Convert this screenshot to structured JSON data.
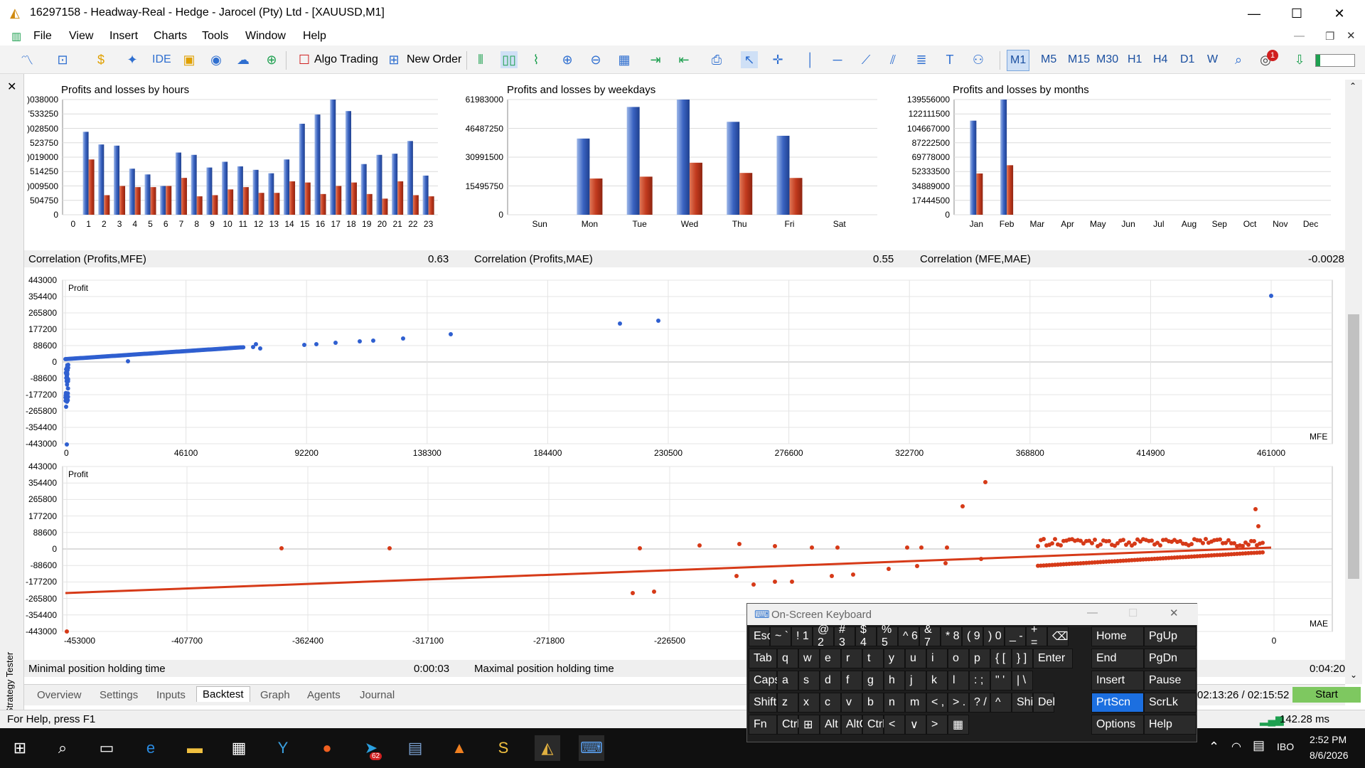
{
  "window": {
    "title": "16297158 - Headway-Real - Hedge - Jarocel (Pty) Ltd - [XAUUSD,M1]",
    "controls": [
      "—",
      "☐",
      "✕"
    ]
  },
  "menu": [
    "File",
    "View",
    "Insert",
    "Charts",
    "Tools",
    "Window",
    "Help"
  ],
  "toolbar": {
    "ide_label": "IDE",
    "algo_label": "Algo Trading",
    "neworder_label": "New Order",
    "timeframes": [
      "M1",
      "M5",
      "M15",
      "M30",
      "H1",
      "H4",
      "D1",
      "W"
    ],
    "selected_tf": "M1",
    "badge": "1"
  },
  "side_panel": {
    "label": "Strategy Tester"
  },
  "charts": {
    "hours_title": "Profits and losses by hours",
    "weekdays_title": "Profits and losses by weekdays",
    "months_title": "Profits and losses by months",
    "hours_yticks": [
      ")038000",
      "'533250",
      ")028500",
      "523750",
      ")019000",
      "514250",
      ")009500",
      "504750",
      "0"
    ],
    "weekdays_yticks": [
      "61983000",
      "46487250",
      "30991500",
      "15495750",
      "0"
    ],
    "months_yticks": [
      "139556000",
      "122111500",
      "104667000",
      "87222500",
      "69778000",
      "52333500",
      "34889000",
      "17444500",
      "0"
    ]
  },
  "correlation": {
    "c1_label": "Correlation (Profits,MFE)",
    "c1_value": "0.63",
    "c2_label": "Correlation (Profits,MAE)",
    "c2_value": "0.55",
    "c3_label": "Correlation (MFE,MAE)",
    "c3_value": "-0.0028"
  },
  "scatter": {
    "yticks": [
      "443000",
      "354400",
      "265800",
      "177200",
      "88600",
      "0",
      "-88600",
      "-177200",
      "-265800",
      "-354400",
      "-443000"
    ],
    "mfe_xticks": [
      "0",
      "46100",
      "92200",
      "138300",
      "184400",
      "230500",
      "276600",
      "322700",
      "368800",
      "414900",
      "461000"
    ],
    "mae_xticks": [
      "-453000",
      "-407700",
      "-362400",
      "-317100",
      "-271800",
      "-226500",
      "0"
    ],
    "profit_label": "Profit",
    "mfe_label": "MFE",
    "mae_label": "MAE"
  },
  "holding": {
    "min_label": "Minimal position holding time",
    "min_value": "0:00:03",
    "max_label": "Maximal position holding time",
    "max_value": "0:04:20"
  },
  "tabs": [
    "Overview",
    "Settings",
    "Inputs",
    "Backtest",
    "Graph",
    "Agents",
    "Journal"
  ],
  "active_tab": "Backtest",
  "progress": {
    "time": "02:13:26 / 02:15:52",
    "start_label": "Start"
  },
  "status": {
    "help": "For Help, press F1",
    "ping": "142.28 ms"
  },
  "osk": {
    "title": "On-Screen Keyboard",
    "row1": [
      "Esc",
      "~ `",
      "! 1",
      "@ 2",
      "# 3",
      "$ 4",
      "% 5",
      "^ 6",
      "& 7",
      "* 8",
      "( 9",
      ") 0",
      "_ -",
      "+ =",
      "⌫"
    ],
    "row2": [
      "Tab",
      "q",
      "w",
      "e",
      "r",
      "t",
      "y",
      "u",
      "i",
      "o",
      "p",
      "{ [",
      "} ]",
      "Enter"
    ],
    "row3": [
      "Caps",
      "a",
      "s",
      "d",
      "f",
      "g",
      "h",
      "j",
      "k",
      "l",
      ": ;",
      "\" '",
      "| \\"
    ],
    "row4": [
      "Shift",
      "z",
      "x",
      "c",
      "v",
      "b",
      "n",
      "m",
      "< ,",
      "> .",
      "? /",
      "^",
      "Shift",
      "Del"
    ],
    "row5": [
      "Fn",
      "Ctrl",
      "⊞",
      "Alt",
      "AltGr",
      "Ctrl",
      "<",
      "∨",
      ">",
      "▦"
    ],
    "nav": [
      [
        "Home",
        "PgUp"
      ],
      [
        "End",
        "PgDn"
      ],
      [
        "Insert",
        "Pause"
      ],
      [
        "PrtScn",
        "ScrLk"
      ],
      [
        "Options",
        "Help"
      ]
    ]
  },
  "taskbar": {
    "time": "2:52 PM",
    "date": "8/6/2026",
    "lang": "IBO",
    "telegram_badge": "62"
  },
  "chart_data": [
    {
      "type": "bar",
      "title": "Profits and losses by hours",
      "categories": [
        "0",
        "1",
        "2",
        "3",
        "4",
        "5",
        "6",
        "7",
        "8",
        "9",
        "10",
        "11",
        "12",
        "13",
        "14",
        "15",
        "16",
        "17",
        "18",
        "19",
        "20",
        "21",
        "22",
        "23"
      ],
      "series": [
        {
          "values": [
            0,
            0.72,
            0.61,
            0.6,
            0.4,
            0.35,
            0.25,
            0.54,
            0.52,
            0.41,
            0.46,
            0.42,
            0.39,
            0.36,
            0.48,
            0.79,
            0.87,
            1.0,
            0.9,
            0.44,
            0.52,
            0.53,
            0.64,
            0.34
          ]
        },
        {
          "values": [
            0,
            0.48,
            0.17,
            0.25,
            0.24,
            0.24,
            0.25,
            0.32,
            0.16,
            0.17,
            0.22,
            0.24,
            0.19,
            0.19,
            0.29,
            0.28,
            0.18,
            0.25,
            0.28,
            0.18,
            0.14,
            0.29,
            0.17,
            0.16
          ]
        }
      ]
    },
    {
      "type": "bar",
      "title": "Profits and losses by weekdays",
      "categories": [
        "Sun",
        "Mon",
        "Tue",
        "Wed",
        "Thu",
        "Fri",
        "Sat"
      ],
      "series": [
        {
          "values": [
            0,
            41000000,
            58000000,
            61983000,
            50000000,
            42500000,
            0
          ]
        },
        {
          "values": [
            0,
            19500000,
            20500000,
            28000000,
            22500000,
            19800000,
            0
          ]
        }
      ]
    },
    {
      "type": "bar",
      "title": "Profits and losses by months",
      "categories": [
        "Jan",
        "Feb",
        "Mar",
        "Apr",
        "May",
        "Jun",
        "Jul",
        "Aug",
        "Sep",
        "Oct",
        "Nov",
        "Dec"
      ],
      "series": [
        {
          "values": [
            114000000,
            139556000,
            0,
            0,
            0,
            0,
            0,
            0,
            0,
            0,
            0,
            0
          ]
        },
        {
          "values": [
            50000000,
            60000000,
            0,
            0,
            0,
            0,
            0,
            0,
            0,
            0,
            0,
            0
          ]
        }
      ]
    }
  ]
}
